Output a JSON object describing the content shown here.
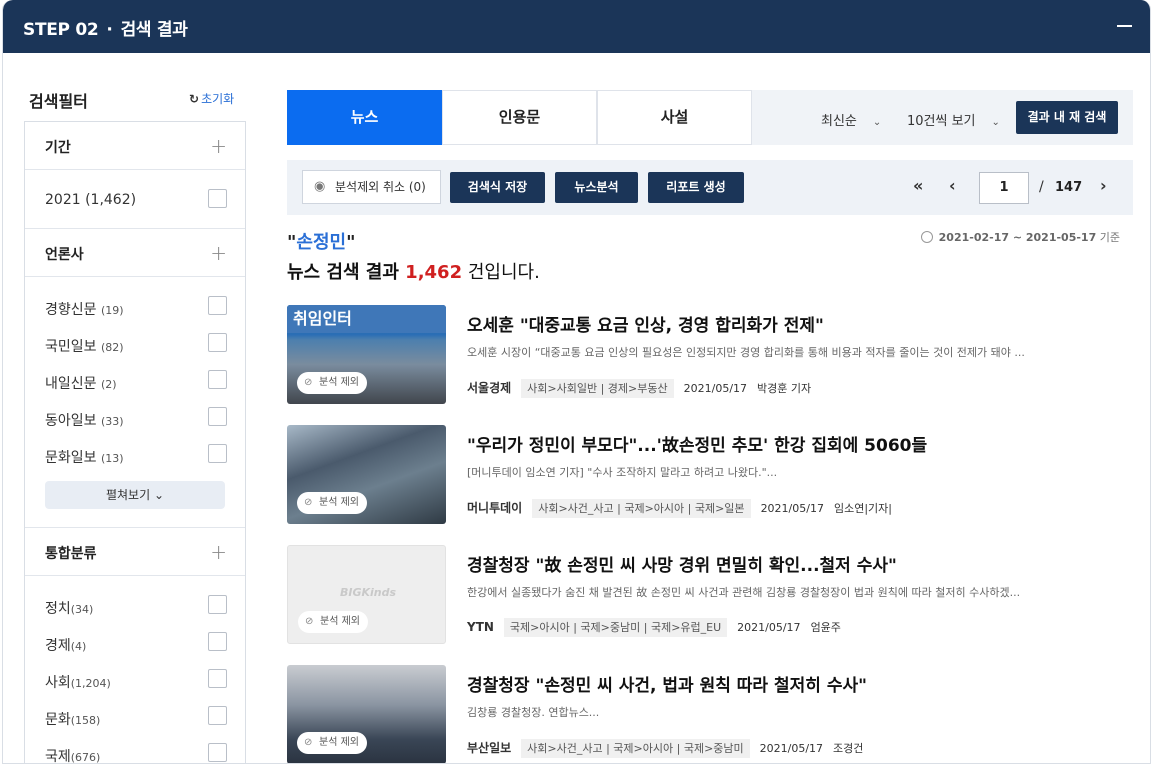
{
  "header": {
    "step": "STEP 02",
    "dot": "·",
    "title": "검색 결과"
  },
  "filter": {
    "title": "검색필터",
    "reset": "초기화",
    "sections": {
      "period": {
        "label": "기간",
        "items": [
          {
            "label": "2021 (1,462)"
          }
        ]
      },
      "press": {
        "label": "언론사",
        "items": [
          {
            "label": "경향신문",
            "count": "(19)"
          },
          {
            "label": "국민일보",
            "count": "(82)"
          },
          {
            "label": "내일신문",
            "count": "(2)"
          },
          {
            "label": "동아일보",
            "count": "(33)"
          },
          {
            "label": "문화일보",
            "count": "(13)"
          }
        ],
        "expand": "펼쳐보기"
      },
      "category": {
        "label": "통합분류",
        "items": [
          {
            "label": "정치",
            "count": "(34)"
          },
          {
            "label": "경제",
            "count": "(4)"
          },
          {
            "label": "사회",
            "count": "(1,204)"
          },
          {
            "label": "문화",
            "count": "(158)"
          },
          {
            "label": "국제",
            "count": "(676)"
          }
        ]
      }
    }
  },
  "tabs": [
    {
      "label": "뉴스",
      "active": true
    },
    {
      "label": "인용문"
    },
    {
      "label": "사설"
    }
  ],
  "sort": {
    "order": "최신순",
    "per_page": "10건씩 보기",
    "research": "결과 내 재 검색"
  },
  "actions": {
    "exclude_cancel": "분석제외 취소 (0)",
    "save_query": "검색식 저장",
    "news_analysis": "뉴스분석",
    "report": "리포트 생성"
  },
  "pager": {
    "first": "«",
    "prev": "‹",
    "current": "1",
    "slash": "/",
    "total": "147",
    "next": "›"
  },
  "result": {
    "keyword_open": "\"",
    "keyword": "손정민",
    "keyword_close": "\"",
    "prefix": "뉴스 검색 결과 ",
    "count": "1,462",
    "suffix": " 건입니다.",
    "range_dates": "2021-02-17 ~ 2021-05-17",
    "range_suffix": "기준"
  },
  "articles": [
    {
      "title": "오세훈 \"대중교통 요금 인상, 경영 합리화가 전제\"",
      "snippet": "오세훈 시장이 “대중교통 요금 인상의 필요성은 인정되지만 경영 합리화를 통해 비용과 적자를 줄이는 것이 전제가 돼야 ...",
      "press": "서울경제",
      "category": "사회>사회일반 | 경제>부동산",
      "date": "2021/05/17",
      "reporter": "박경훈 기자",
      "exclude": "분석 제외",
      "thumb_banner": "취임인터"
    },
    {
      "title": "\"우리가 정민이 부모다\"...'故손정민 추모' 한강 집회에 5060들",
      "snippet": "[머니투데이 임소연 기자] \"수사 조작하지 말라고 하려고 나왔다.\"...",
      "press": "머니투데이",
      "category": "사회>사건_사고 | 국제>아시아 | 국제>일본",
      "date": "2021/05/17",
      "reporter": "임소연|기자|",
      "exclude": "분석 제외"
    },
    {
      "title": "경찰청장 \"故 손정민 씨 사망 경위 면밀히 확인...철저 수사\"",
      "snippet": "한강에서 실종됐다가 숨진 채 발견된 故 손정민 씨 사건과 관련해 김창룡 경찰청장이 법과 원칙에 따라 철저히 수사하겠...",
      "press": "YTN",
      "category": "국제>아시아 | 국제>중남미 | 국제>유럽_EU",
      "date": "2021/05/17",
      "reporter": "엄윤주",
      "exclude": "분석 제외",
      "thumb_logo": "BIGKinds"
    },
    {
      "title": "경찰청장 \"손정민 씨 사건, 법과 원칙 따라 철저히 수사\"",
      "snippet": "김창룡 경찰청장. 연합뉴스...",
      "press": "부산일보",
      "category": "사회>사건_사고 | 국제>아시아 | 국제>중남미",
      "date": "2021/05/17",
      "reporter": "조경건",
      "exclude": "분석 제외"
    }
  ],
  "colors": {
    "header": "#1b3558",
    "active_tab": "#0b6cf0",
    "count": "#d02020",
    "keyword": "#2a6fd6"
  }
}
